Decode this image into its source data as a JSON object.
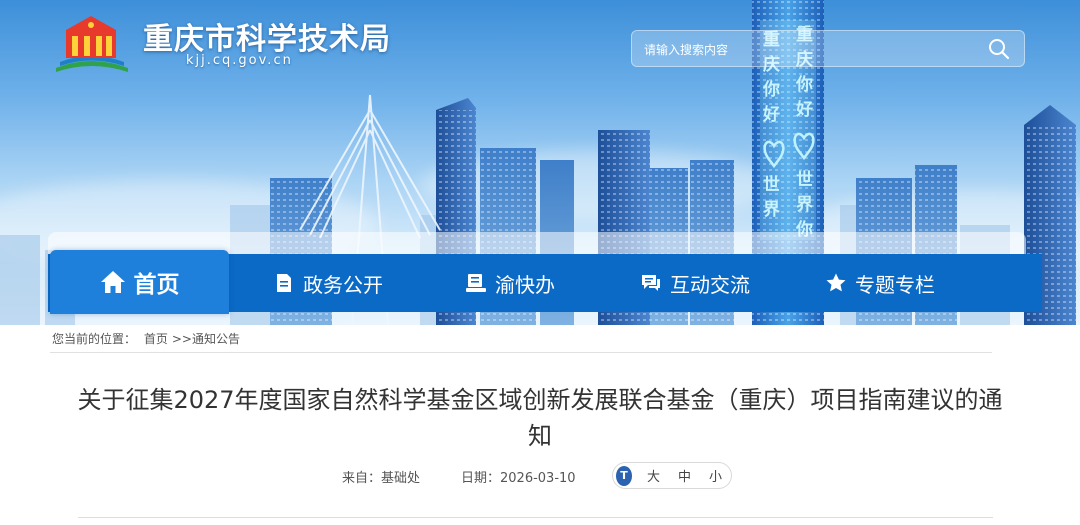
{
  "header": {
    "site_title": "重庆市科学技术局",
    "site_domain": "kjj.cq.gov.cn",
    "tower_text": "重庆你好 世界你好"
  },
  "search": {
    "placeholder": "请输入搜索内容",
    "icon": "search-icon"
  },
  "nav": {
    "items": [
      {
        "label": "首页",
        "icon": "home-icon",
        "active": true
      },
      {
        "label": "政务公开",
        "icon": "document-icon"
      },
      {
        "label": "渝快办",
        "icon": "service-desk-icon"
      },
      {
        "label": "互动交流",
        "icon": "chat-bubble-icon"
      },
      {
        "label": "专题专栏",
        "icon": "star-icon"
      }
    ]
  },
  "breadcrumb": {
    "prefix": "您当前的位置：",
    "home": "首页",
    "separator": ">>",
    "current": "通知公告"
  },
  "article": {
    "title": "关于征集2027年度国家自然科学基金区域创新发展联合基金（重庆）项目指南建议的通知",
    "source_label": "来自：",
    "source": "基础处",
    "date_label": "日期：",
    "date": "2026-03-10"
  },
  "font_size": {
    "icon_glyph": "T",
    "large": "大",
    "medium": "中",
    "small": "小"
  },
  "colors": {
    "nav_bg": "#0b6ac6",
    "nav_active": "#1e80db",
    "tower_glow": "#9ee4ff"
  }
}
